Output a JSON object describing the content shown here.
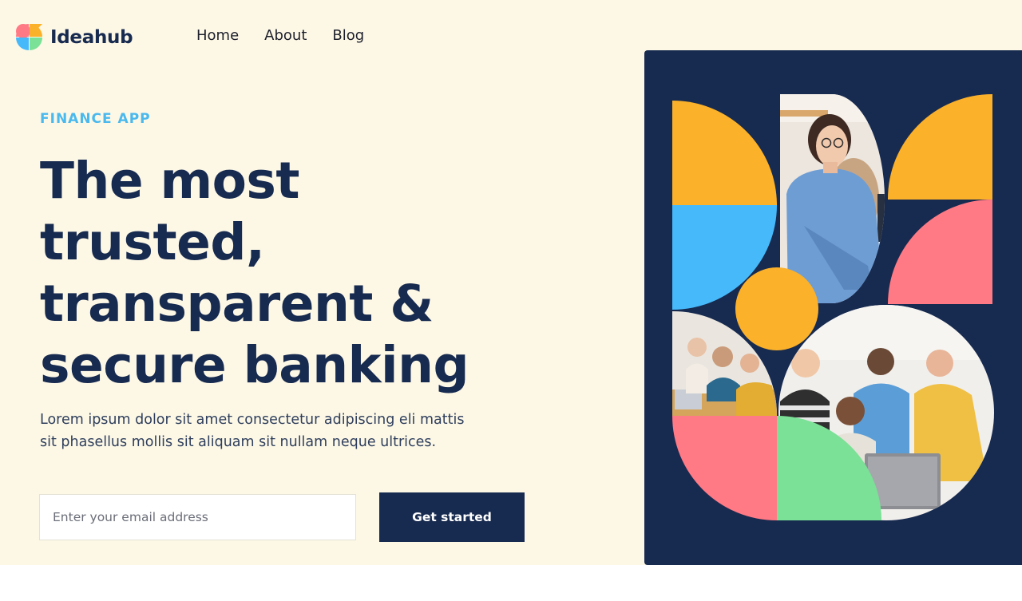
{
  "brand": {
    "name": "Ideahub",
    "logo_icon": "ideahub-logo-icon",
    "colors": {
      "navy": "#172a4f",
      "cream": "#fdf8e6",
      "sky": "#4ab9ee",
      "yellow": "#fbb12a",
      "blue": "#46b9fb",
      "pink": "#ff7a84",
      "green": "#7ae196"
    }
  },
  "nav": {
    "items": [
      {
        "label": "Home"
      },
      {
        "label": "About"
      },
      {
        "label": "Blog"
      }
    ]
  },
  "hero": {
    "eyebrow": "FINANCE APP",
    "headline_lines": [
      "The most",
      "trusted,",
      "transparent &",
      "secure banking"
    ],
    "description_lines": [
      "Lorem ipsum dolor sit amet consectetur adipiscing eli mattis",
      "sit phasellus mollis sit aliquam sit nullam neque ultrices."
    ],
    "email_placeholder": "Enter your email address",
    "cta_label": "Get started"
  },
  "illustration": {
    "photos": [
      "woman-with-glasses-photo",
      "small-team-meeting-photo",
      "group-with-laptop-photo"
    ]
  }
}
